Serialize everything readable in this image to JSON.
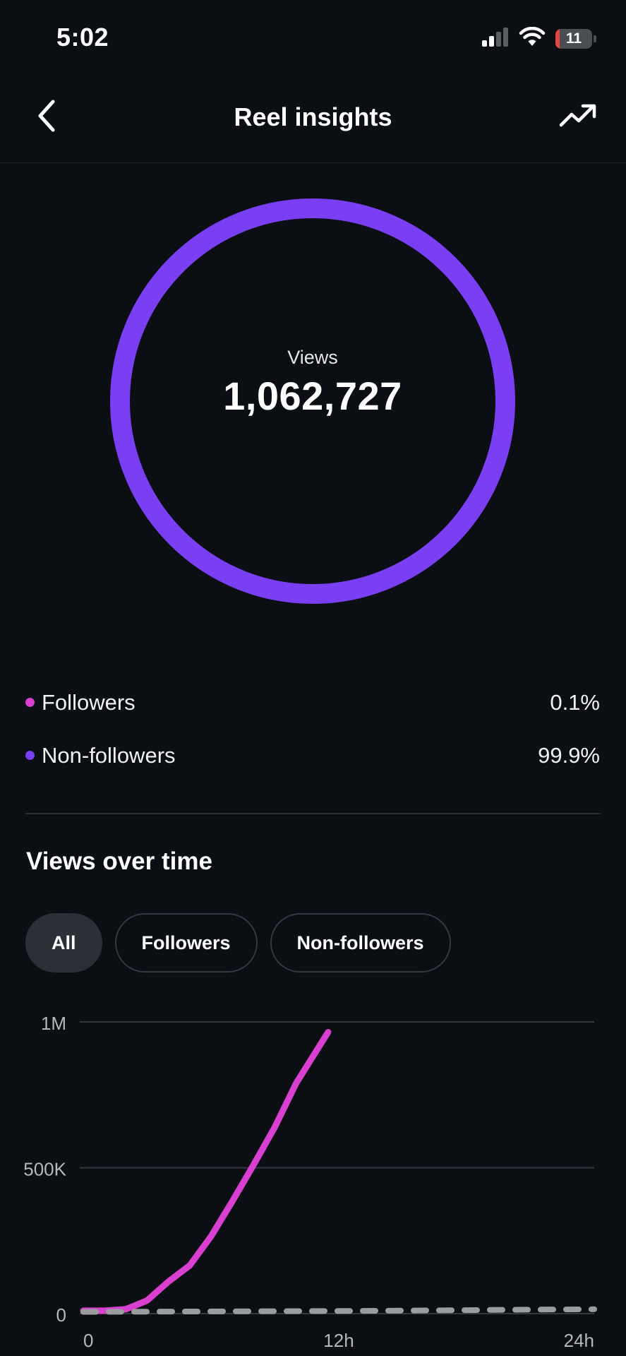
{
  "status_bar": {
    "time": "5:02",
    "battery_level": "11",
    "icons": [
      "cellular-signal-icon",
      "wifi-icon",
      "battery-icon"
    ]
  },
  "header": {
    "title": "Reel insights",
    "back_icon": "chevron-left-icon",
    "trend_icon": "trending-up-icon"
  },
  "summary": {
    "label": "Views",
    "value": "1,062,727"
  },
  "audience": [
    {
      "label": "Followers",
      "value": "0.1%",
      "color": "#d93fd0"
    },
    {
      "label": "Non-followers",
      "value": "99.9%",
      "color": "#7a3ff2"
    }
  ],
  "views_over_time": {
    "title": "Views over time",
    "filters": [
      {
        "label": "All",
        "active": true
      },
      {
        "label": "Followers",
        "active": false
      },
      {
        "label": "Non-followers",
        "active": false
      }
    ]
  },
  "colors": {
    "background": "#0b0e13",
    "non_followers": "#7a3ff2",
    "followers": "#d93fd0",
    "series_line": "#d93fd0",
    "reference_dashed": "#9a9ca0",
    "grid": "#33373e"
  },
  "chart_data": {
    "type": "line",
    "title": "",
    "xlabel": "",
    "ylabel": "",
    "x_ticks": [
      {
        "value": 0,
        "label": "0"
      },
      {
        "value": 12,
        "label": "12h"
      },
      {
        "value": 24,
        "label": "24h"
      }
    ],
    "y_ticks": [
      {
        "value": 0,
        "label": "0"
      },
      {
        "value": 500000,
        "label": "500K"
      },
      {
        "value": 1000000,
        "label": "1M"
      }
    ],
    "xlim": [
      0,
      24
    ],
    "ylim": [
      0,
      1000000
    ],
    "grid": true,
    "series": [
      {
        "style": "solid",
        "color": "#d93fd0",
        "x": [
          0,
          1,
          2,
          3,
          4,
          5,
          6,
          7,
          8,
          9,
          10,
          11.5
        ],
        "y": [
          10000,
          10000,
          15000,
          45000,
          110000,
          165000,
          265000,
          385000,
          510000,
          640000,
          790000,
          965000
        ]
      },
      {
        "style": "dashed",
        "color": "#9a9ca0",
        "x": [
          0,
          4,
          8,
          12,
          16,
          20,
          24
        ],
        "y": [
          6000,
          7000,
          8000,
          9000,
          11000,
          13000,
          15000
        ]
      }
    ]
  }
}
